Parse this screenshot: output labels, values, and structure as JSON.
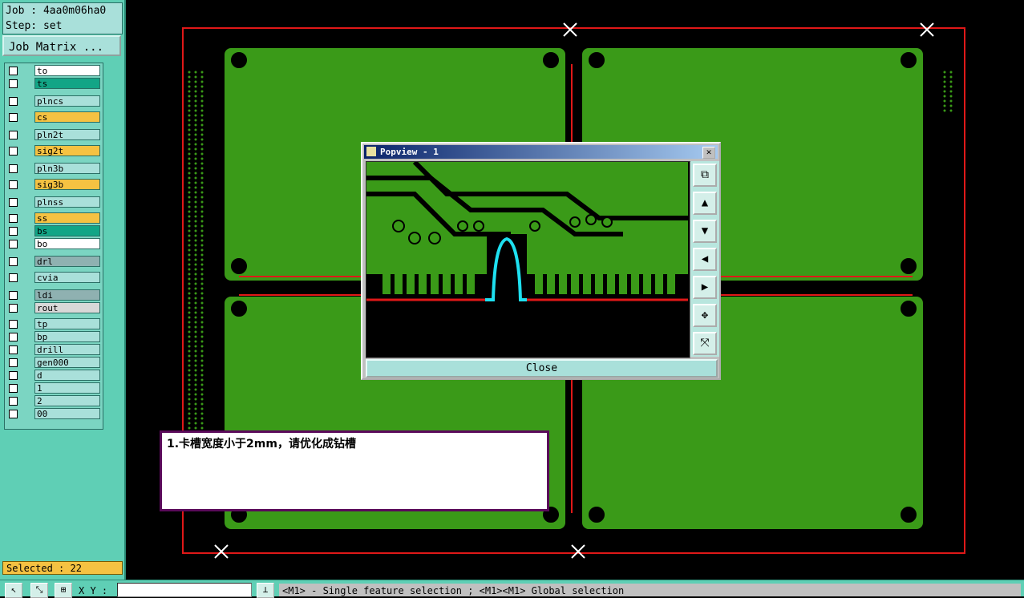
{
  "job": {
    "job_line": "Job : 4aa0m06ha0",
    "step_line": "Step: set"
  },
  "job_matrix_label": "Job Matrix ...",
  "layers": [
    {
      "name": "to",
      "color": "#ffffff"
    },
    {
      "name": "ts",
      "color": "#12a586"
    },
    {
      "name": "plncs",
      "color": "#a9e0da"
    },
    {
      "name": "cs",
      "color": "#f5c242"
    },
    {
      "name": "pln2t",
      "color": "#a9e0da"
    },
    {
      "name": "sig2t",
      "color": "#f5c242"
    },
    {
      "name": "pln3b",
      "color": "#a9e0da"
    },
    {
      "name": "sig3b",
      "color": "#f5c242"
    },
    {
      "name": "plnss",
      "color": "#a9e0da"
    },
    {
      "name": "ss",
      "color": "#f5c242"
    },
    {
      "name": "bs",
      "color": "#12a586"
    },
    {
      "name": "bo",
      "color": "#ffffff"
    },
    {
      "name": "drl",
      "color": "#8fb1b1"
    },
    {
      "name": "cvia",
      "color": "#a9e0da"
    },
    {
      "name": "ldi",
      "color": "#8fb1b1"
    },
    {
      "name": "rout",
      "color": "#d8d8d8"
    },
    {
      "name": "tp",
      "color": "#a9e0da"
    },
    {
      "name": "bp",
      "color": "#a9e0da"
    },
    {
      "name": "drill",
      "color": "#a9e0da"
    },
    {
      "name": "gen000",
      "color": "#a9e0da"
    },
    {
      "name": "d",
      "color": "#a9e0da"
    },
    {
      "name": "1",
      "color": "#a9e0da"
    },
    {
      "name": "2",
      "color": "#a9e0da"
    },
    {
      "name": "00",
      "color": "#a9e0da"
    }
  ],
  "selected_text": "Selected : 22",
  "popup": {
    "title": "Popview - 1",
    "close_label": "Close",
    "close_x": "✕",
    "tools": [
      "zoom-fit-icon",
      "pan-up-icon",
      "pan-down-icon",
      "pan-left-icon",
      "pan-right-icon",
      "zoom-out-icon",
      "zoom-in-icon"
    ],
    "tool_glyphs": [
      "⧉",
      "▲",
      "▼",
      "◀",
      "▶",
      "✥",
      "⤧"
    ]
  },
  "note_text": "1.卡槽宽度小于2mm，请优化成钻槽",
  "bottom": {
    "xy_label": "X Y :",
    "status": "<M1> - Single feature selection ; <M1><M1> Global selection",
    "btn_glyphs": [
      "↖",
      "⤡",
      "⊞",
      "⊥"
    ]
  },
  "colors": {
    "board_green": "#3a9a18",
    "rout_red": "#e01818",
    "slot_cyan": "#1ee0f0",
    "panel_bg": "#5fcfb5"
  }
}
